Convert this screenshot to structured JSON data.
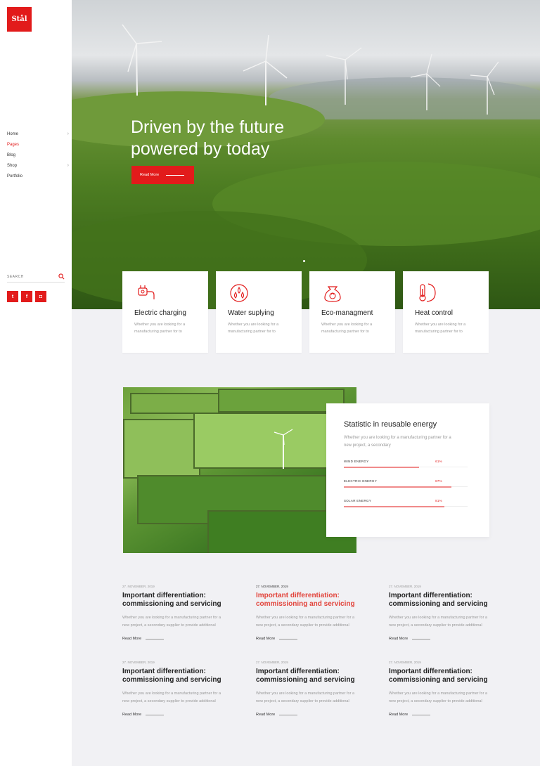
{
  "brand": {
    "logo": "Stål",
    "accent": "#e21b1b"
  },
  "nav": [
    {
      "label": "Home",
      "has_children": true,
      "chev": "›"
    },
    {
      "label": "Pages",
      "has_children": false,
      "chev": ""
    },
    {
      "label": "Blog",
      "has_children": false,
      "chev": ""
    },
    {
      "label": "Shop",
      "has_children": true,
      "chev": "›"
    },
    {
      "label": "Portfolio",
      "has_children": false,
      "chev": ""
    }
  ],
  "search": {
    "placeholder": "SEARCH"
  },
  "socials": [
    {
      "name": "twitter",
      "glyph": "t"
    },
    {
      "name": "facebook",
      "glyph": "f"
    },
    {
      "name": "instagram",
      "glyph": "◘"
    }
  ],
  "hero": {
    "title_line1": "Driven by the future",
    "title_line2": "powered by today",
    "button": "Read More"
  },
  "services": [
    {
      "title": "Electric charging",
      "text": "Whether you are looking for a manufacturing partner for to",
      "icon": "plug-icon"
    },
    {
      "title": "Water suplying",
      "text": "Whether you are looking for a manufacturing partner for to",
      "icon": "water-drops-icon"
    },
    {
      "title": "Eco-managment",
      "text": "Whether you are looking for a manufacturing partner for to",
      "icon": "recycle-bag-icon"
    },
    {
      "title": "Heat control",
      "text": "Whether you are looking for a manufacturing partner for to",
      "icon": "thermometer-icon"
    }
  ],
  "stats": {
    "title": "Statistic in reusable energy",
    "text": "Whether you are looking for a manufacturing partner for a new project, a secondary",
    "bars": [
      {
        "label": "WIND ENERGY",
        "pct_label": "61%",
        "value": 0.61
      },
      {
        "label": "ELECTRIC ENERGY",
        "pct_label": "87%",
        "value": 0.87
      },
      {
        "label": "SOLAR ENERGY",
        "pct_label": "81%",
        "value": 0.81
      }
    ]
  },
  "posts": [
    {
      "date": "27. NOVEMBER, 2019",
      "title": "Important differentiation: commissioning and servicing",
      "text": "Whether you are looking for a manufacturing partner for a new project, a secondary supplier to provide additional",
      "more": "Read More",
      "highlight": false
    },
    {
      "date": "27. NOVEMBER, 2019",
      "title": "Important differentiation: commissioning and servicing",
      "text": "Whether you are looking for a manufacturing partner for a new project, a secondary supplier to provide additional",
      "more": "Read More",
      "highlight": true
    },
    {
      "date": "27. NOVEMBER, 2019",
      "title": "Important differentiation: commissioning and servicing",
      "text": "Whether you are looking for a manufacturing partner for a new project, a secondary supplier to provide additional",
      "more": "Read More",
      "highlight": false
    },
    {
      "date": "27. NOVEMBER, 2019",
      "title": "Important differentiation: commissioning and servicing",
      "text": "Whether you are looking for a manufacturing partner for a new project, a secondary supplier to provide additional",
      "more": "Read More",
      "highlight": false
    },
    {
      "date": "27. NOVEMBER, 2019",
      "title": "Important differentiation: commissioning and servicing",
      "text": "Whether you are looking for a manufacturing partner for a new project, a secondary supplier to provide additional",
      "more": "Read More",
      "highlight": false
    },
    {
      "date": "27. NOVEMBER, 2019",
      "title": "Important differentiation: commissioning and servicing",
      "text": "Whether you are looking for a manufacturing partner for a new project, a secondary supplier to provide additional",
      "more": "Read More",
      "highlight": false
    }
  ]
}
